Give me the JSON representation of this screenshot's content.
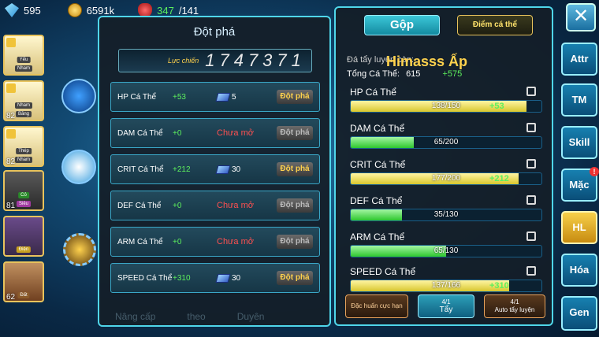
{
  "topbar": {
    "gems": "595",
    "gold": "6591k",
    "stamina": "347",
    "stamina_max": "/141"
  },
  "left_panel": {
    "title": "Đột phá",
    "power_label": "Lực chiến",
    "power_value": "1747371",
    "rows": [
      {
        "name": "HP Cá Thể",
        "bonus": "+53",
        "cost": "5",
        "state": "open"
      },
      {
        "name": "DAM Cá Thể",
        "bonus": "+0",
        "closed": "Chưa mở",
        "state": "closed"
      },
      {
        "name": "CRIT Cá Thể",
        "bonus": "+212",
        "cost": "30",
        "state": "open"
      },
      {
        "name": "DEF Cá Thể",
        "bonus": "+0",
        "closed": "Chưa mở",
        "state": "closed"
      },
      {
        "name": "ARM Cá Thể",
        "bonus": "+0",
        "closed": "Chưa mở",
        "state": "closed"
      },
      {
        "name": "SPEED Cá Thể",
        "bonus": "+310",
        "cost": "30",
        "state": "open"
      }
    ],
    "button_label": "Đột phá",
    "under_tabs": [
      "Nâng cấp",
      "theo",
      "Duyên"
    ]
  },
  "left_cards": [
    {
      "tag": "Yếu",
      "tag2": "Nham",
      "level": "1"
    },
    {
      "tag": "Nham",
      "tag2": "Băng",
      "level": "82"
    },
    {
      "tag": "Thép",
      "tag2": "Nham",
      "level": "82"
    },
    {
      "tag": "Cỏ",
      "tag2": "Siêu",
      "level": "81"
    },
    {
      "tag": "Điện",
      "tag2": "",
      "level": "4"
    },
    {
      "tag": "Đất",
      "tag2": "",
      "level": "62"
    }
  ],
  "right_panel": {
    "tab_gop": "Gộp",
    "tab_diem": "Điểm cá thể",
    "remain_label": "Đá tẩy luyện còn:",
    "overlay_name": "Himasss Ấp",
    "total_label": "Tổng Cá Thể:",
    "total_value": "615",
    "total_add": "+575",
    "stats": [
      {
        "name": "HP Cá Thể",
        "text": "138/150",
        "add": "+53",
        "fill": 0.92,
        "gold": true
      },
      {
        "name": "DAM Cá Thể",
        "text": "65/200",
        "add": "",
        "fill": 0.33,
        "gold": false
      },
      {
        "name": "CRIT Cá Thể",
        "text": "177/200",
        "add": "+212",
        "fill": 0.88,
        "gold": true
      },
      {
        "name": "DEF Cá Thể",
        "text": "35/130",
        "add": "",
        "fill": 0.27,
        "gold": false
      },
      {
        "name": "ARM Cá Thể",
        "text": "65/130",
        "add": "",
        "fill": 0.5,
        "gold": false
      },
      {
        "name": "SPEED Cá Thể",
        "text": "137/166",
        "add": "+310",
        "fill": 0.83,
        "gold": true
      }
    ],
    "btn_special": "Đặc huấn cực hạn",
    "btn_tay_count": "4/1",
    "btn_tay": "Tẩy",
    "btn_auto_count": "4/1",
    "btn_auto": "Auto tẩy luyện"
  },
  "right_sidebar": [
    "Attr",
    "TM",
    "Skill",
    "Mặc",
    "HL",
    "Hóa",
    "Gen"
  ],
  "colors": {
    "accent": "#4fd6ea",
    "positive": "#5df05d",
    "locked": "#ff5050",
    "gold": "#ffd24d"
  }
}
